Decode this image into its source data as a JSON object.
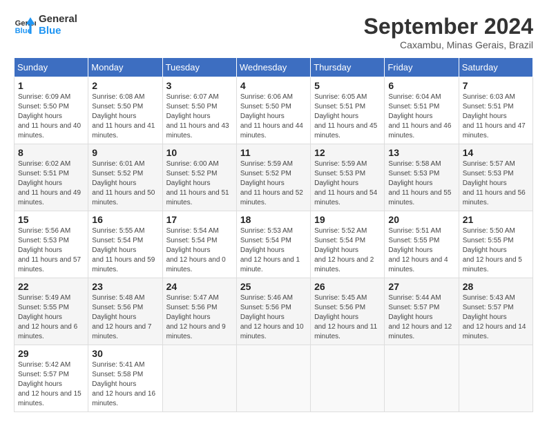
{
  "header": {
    "logo": {
      "line1": "General",
      "line2": "Blue"
    },
    "title": "September 2024",
    "location": "Caxambu, Minas Gerais, Brazil"
  },
  "weekdays": [
    "Sunday",
    "Monday",
    "Tuesday",
    "Wednesday",
    "Thursday",
    "Friday",
    "Saturday"
  ],
  "weeks": [
    [
      {
        "day": "1",
        "sunrise": "6:09 AM",
        "sunset": "5:50 PM",
        "daylight": "11 hours and 40 minutes."
      },
      {
        "day": "2",
        "sunrise": "6:08 AM",
        "sunset": "5:50 PM",
        "daylight": "11 hours and 41 minutes."
      },
      {
        "day": "3",
        "sunrise": "6:07 AM",
        "sunset": "5:50 PM",
        "daylight": "11 hours and 43 minutes."
      },
      {
        "day": "4",
        "sunrise": "6:06 AM",
        "sunset": "5:50 PM",
        "daylight": "11 hours and 44 minutes."
      },
      {
        "day": "5",
        "sunrise": "6:05 AM",
        "sunset": "5:51 PM",
        "daylight": "11 hours and 45 minutes."
      },
      {
        "day": "6",
        "sunrise": "6:04 AM",
        "sunset": "5:51 PM",
        "daylight": "11 hours and 46 minutes."
      },
      {
        "day": "7",
        "sunrise": "6:03 AM",
        "sunset": "5:51 PM",
        "daylight": "11 hours and 47 minutes."
      }
    ],
    [
      {
        "day": "8",
        "sunrise": "6:02 AM",
        "sunset": "5:51 PM",
        "daylight": "11 hours and 49 minutes."
      },
      {
        "day": "9",
        "sunrise": "6:01 AM",
        "sunset": "5:52 PM",
        "daylight": "11 hours and 50 minutes."
      },
      {
        "day": "10",
        "sunrise": "6:00 AM",
        "sunset": "5:52 PM",
        "daylight": "11 hours and 51 minutes."
      },
      {
        "day": "11",
        "sunrise": "5:59 AM",
        "sunset": "5:52 PM",
        "daylight": "11 hours and 52 minutes."
      },
      {
        "day": "12",
        "sunrise": "5:59 AM",
        "sunset": "5:53 PM",
        "daylight": "11 hours and 54 minutes."
      },
      {
        "day": "13",
        "sunrise": "5:58 AM",
        "sunset": "5:53 PM",
        "daylight": "11 hours and 55 minutes."
      },
      {
        "day": "14",
        "sunrise": "5:57 AM",
        "sunset": "5:53 PM",
        "daylight": "11 hours and 56 minutes."
      }
    ],
    [
      {
        "day": "15",
        "sunrise": "5:56 AM",
        "sunset": "5:53 PM",
        "daylight": "11 hours and 57 minutes."
      },
      {
        "day": "16",
        "sunrise": "5:55 AM",
        "sunset": "5:54 PM",
        "daylight": "11 hours and 59 minutes."
      },
      {
        "day": "17",
        "sunrise": "5:54 AM",
        "sunset": "5:54 PM",
        "daylight": "12 hours and 0 minutes."
      },
      {
        "day": "18",
        "sunrise": "5:53 AM",
        "sunset": "5:54 PM",
        "daylight": "12 hours and 1 minute."
      },
      {
        "day": "19",
        "sunrise": "5:52 AM",
        "sunset": "5:54 PM",
        "daylight": "12 hours and 2 minutes."
      },
      {
        "day": "20",
        "sunrise": "5:51 AM",
        "sunset": "5:55 PM",
        "daylight": "12 hours and 4 minutes."
      },
      {
        "day": "21",
        "sunrise": "5:50 AM",
        "sunset": "5:55 PM",
        "daylight": "12 hours and 5 minutes."
      }
    ],
    [
      {
        "day": "22",
        "sunrise": "5:49 AM",
        "sunset": "5:55 PM",
        "daylight": "12 hours and 6 minutes."
      },
      {
        "day": "23",
        "sunrise": "5:48 AM",
        "sunset": "5:56 PM",
        "daylight": "12 hours and 7 minutes."
      },
      {
        "day": "24",
        "sunrise": "5:47 AM",
        "sunset": "5:56 PM",
        "daylight": "12 hours and 9 minutes."
      },
      {
        "day": "25",
        "sunrise": "5:46 AM",
        "sunset": "5:56 PM",
        "daylight": "12 hours and 10 minutes."
      },
      {
        "day": "26",
        "sunrise": "5:45 AM",
        "sunset": "5:56 PM",
        "daylight": "12 hours and 11 minutes."
      },
      {
        "day": "27",
        "sunrise": "5:44 AM",
        "sunset": "5:57 PM",
        "daylight": "12 hours and 12 minutes."
      },
      {
        "day": "28",
        "sunrise": "5:43 AM",
        "sunset": "5:57 PM",
        "daylight": "12 hours and 14 minutes."
      }
    ],
    [
      {
        "day": "29",
        "sunrise": "5:42 AM",
        "sunset": "5:57 PM",
        "daylight": "12 hours and 15 minutes."
      },
      {
        "day": "30",
        "sunrise": "5:41 AM",
        "sunset": "5:58 PM",
        "daylight": "12 hours and 16 minutes."
      },
      null,
      null,
      null,
      null,
      null
    ]
  ]
}
